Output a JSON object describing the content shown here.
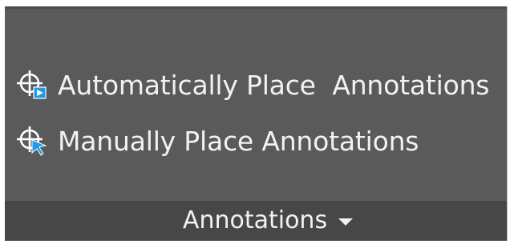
{
  "panel": {
    "commands": [
      {
        "label": "Automatically Place  Annotations",
        "icon": "auto-place-annotation-icon"
      },
      {
        "label": "Manually Place Annotations",
        "icon": "manual-place-annotation-icon"
      }
    ],
    "footer": {
      "title": "Annotations",
      "dropdown_icon": "caret-down-icon"
    }
  },
  "colors": {
    "panel_bg": "#5a5a5a",
    "footer_bg": "#474747",
    "text": "#f2f2f2",
    "icon_accent": "#1e9be8"
  }
}
